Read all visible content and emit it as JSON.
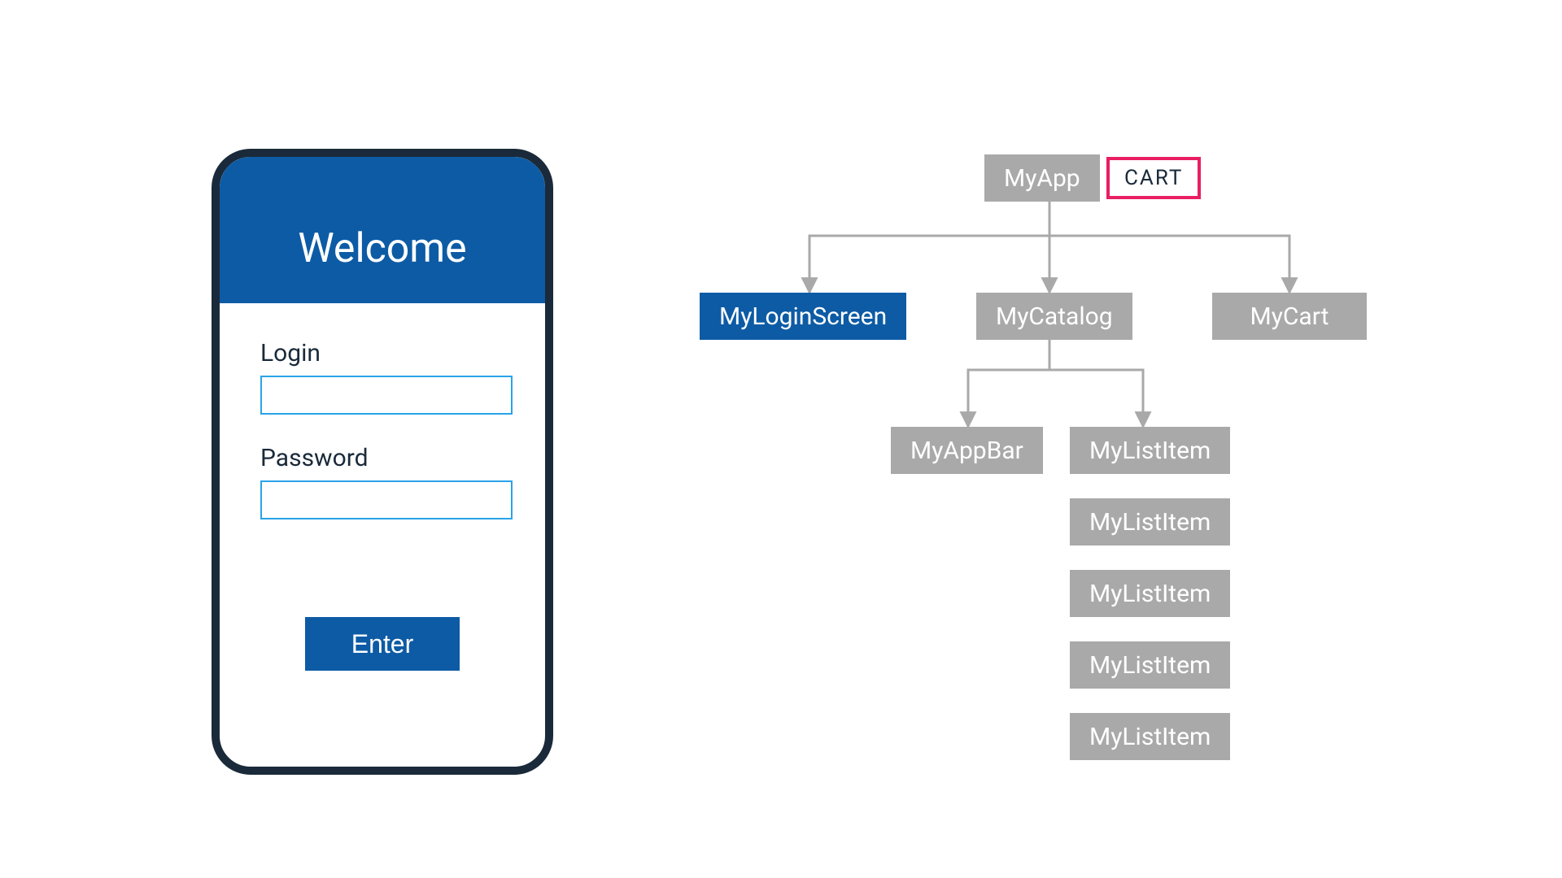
{
  "phone": {
    "title": "Welcome",
    "login_label": "Login",
    "password_label": "Password",
    "enter_label": "Enter"
  },
  "tree": {
    "root": "MyApp",
    "state_badge": "CART",
    "children": {
      "login": "MyLoginScreen",
      "catalog": "MyCatalog",
      "cart": "MyCart"
    },
    "catalog_children": {
      "appbar": "MyAppBar",
      "list_item_label": "MyListItem",
      "list_item_count": 5
    }
  },
  "colors": {
    "primary_blue": "#0d5ba5",
    "node_gray": "#a9a9a9",
    "input_border": "#2aa3e8",
    "phone_border": "#1a2a3a",
    "state_accent": "#e91e63"
  }
}
